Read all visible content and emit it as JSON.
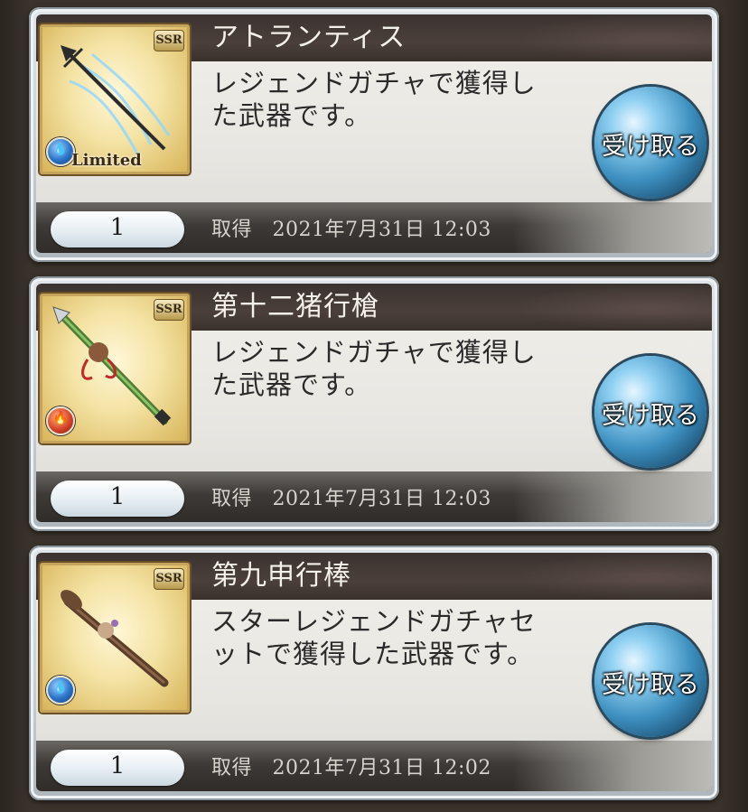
{
  "items": [
    {
      "title": "アトランティス",
      "description": "レジェンドガチャで獲得した武器です。",
      "quantity": "1",
      "acquired": "取得　2021年7月31日 12:03",
      "rarity": "SSR",
      "element": "water",
      "limited_label": "Limited",
      "button_label": "受け取る"
    },
    {
      "title": "第十二猪行槍",
      "description": "レジェンドガチャで獲得した武器です。",
      "quantity": "1",
      "acquired": "取得　2021年7月31日 12:03",
      "rarity": "SSR",
      "element": "fire",
      "button_label": "受け取る"
    },
    {
      "title": "第九申行棒",
      "description": "スターレジェンドガチャセットで獲得した武器です。",
      "quantity": "1",
      "acquired": "取得　2021年7月31日 12:02",
      "rarity": "SSR",
      "element": "water",
      "button_label": "受け取る"
    }
  ],
  "colors": {
    "title_bar": "#3b3330",
    "card_border": "#dfe5e9",
    "button_blue": "#3d8fbf",
    "thumb_gold": "#f4e3a4"
  }
}
